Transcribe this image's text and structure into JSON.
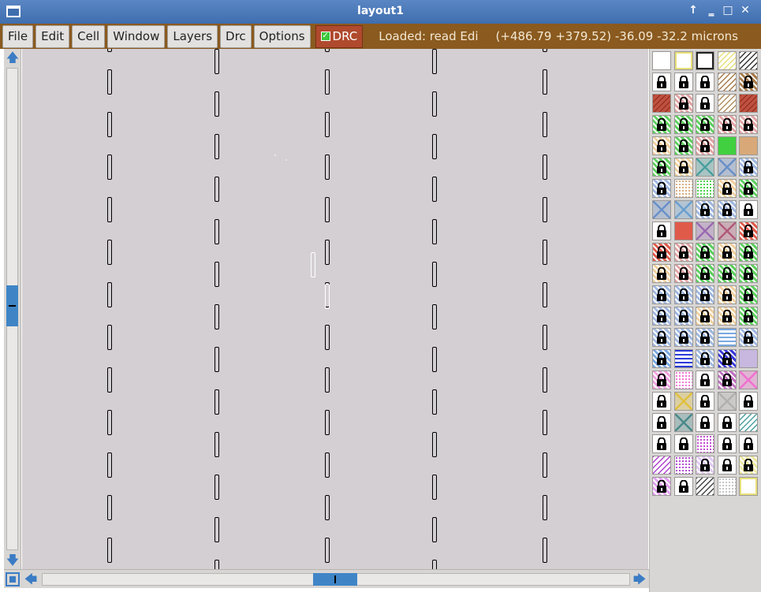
{
  "window": {
    "title": "layout1",
    "controls": [
      "↑",
      "‗",
      "□",
      "✕"
    ]
  },
  "menu": {
    "items": [
      "File",
      "Edit",
      "Cell",
      "Window",
      "Layers",
      "Drc",
      "Options"
    ],
    "drc_toggle_label": "DRC",
    "drc_checked": true,
    "status": "Loaded: read Edi",
    "coords": "(+486.79 +379.52) -36.09 -32.2 microns"
  },
  "colors": {
    "title_bar": "#4a7bbd",
    "menu_bar": "#8a5a1f",
    "drc_button": "#b04a2e",
    "canvas": "#d4cfd3",
    "scroll_thumb": "#3f85c6"
  },
  "scrollbars": {
    "vertical_position": 0.5,
    "horizontal_position": 0.55
  },
  "canvas": {
    "pattern": "repeating column of vertical dash outlines (layout geometry)",
    "selected_shapes": 2
  },
  "layers": [
    {
      "style": "dots",
      "color": "#ffffff"
    },
    {
      "style": "outline",
      "color": "#e8e07a"
    },
    {
      "style": "outline",
      "color": "#222222"
    },
    {
      "style": "diag",
      "color": "#e8e07a"
    },
    {
      "style": "diag",
      "color": "#333333"
    },
    {
      "style": "lock",
      "color": "#ffffff"
    },
    {
      "style": "lock",
      "color": "#ffffff"
    },
    {
      "style": "lock",
      "color": "#ffffff"
    },
    {
      "style": "diag",
      "color": "#a77b4a"
    },
    {
      "style": "lock",
      "color": "#a77b4a"
    },
    {
      "style": "solid-diag",
      "color": "#c0503e"
    },
    {
      "style": "lock",
      "color": "#e2a4a4"
    },
    {
      "style": "lock",
      "color": "#ffffff"
    },
    {
      "style": "diag",
      "color": "#b09060"
    },
    {
      "style": "solid-diag",
      "color": "#c0503e"
    },
    {
      "style": "lock",
      "color": "#5fd05f"
    },
    {
      "style": "lock",
      "color": "#5fd05f"
    },
    {
      "style": "lock",
      "color": "#5fd05f"
    },
    {
      "style": "lock",
      "color": "#e2a4a4"
    },
    {
      "style": "lock",
      "color": "#e2a4a4"
    },
    {
      "style": "lock",
      "color": "#f0d0a0"
    },
    {
      "style": "lock",
      "color": "#5fd05f"
    },
    {
      "style": "lock",
      "color": "#e2a4a4"
    },
    {
      "style": "solid",
      "color": "#40d040"
    },
    {
      "style": "solid",
      "color": "#d8a878"
    },
    {
      "style": "lock",
      "color": "#5fd05f"
    },
    {
      "style": "lock",
      "color": "#f0d0a0"
    },
    {
      "style": "cross",
      "color": "#4aa0a0"
    },
    {
      "style": "cross",
      "color": "#6a90c8"
    },
    {
      "style": "lock",
      "color": "#a0b8e0"
    },
    {
      "style": "lock",
      "color": "#a0b8e0"
    },
    {
      "style": "dots",
      "color": "#d8a878"
    },
    {
      "style": "dots",
      "color": "#40d040"
    },
    {
      "style": "lock",
      "color": "#f0d0a0"
    },
    {
      "style": "lock",
      "color": "#5fd05f"
    },
    {
      "style": "cross",
      "color": "#6a90c8"
    },
    {
      "style": "cross",
      "color": "#6aa0d0"
    },
    {
      "style": "lock",
      "color": "#a0b8e0"
    },
    {
      "style": "lock",
      "color": "#a0b8e0"
    },
    {
      "style": "lock",
      "color": "#ffffff"
    },
    {
      "style": "lock",
      "color": "#ffffff"
    },
    {
      "style": "solid",
      "color": "#e05a4a"
    },
    {
      "style": "cross",
      "color": "#9a6ab0"
    },
    {
      "style": "cross",
      "color": "#b05a7a"
    },
    {
      "style": "lock",
      "color": "#e05a4a"
    },
    {
      "style": "lock",
      "color": "#e05a4a"
    },
    {
      "style": "lock",
      "color": "#e2a4a4"
    },
    {
      "style": "lock",
      "color": "#5fd05f"
    },
    {
      "style": "lock",
      "color": "#f0d0a0"
    },
    {
      "style": "lock",
      "color": "#5fd05f"
    },
    {
      "style": "lock",
      "color": "#f0d0a0"
    },
    {
      "style": "lock",
      "color": "#e2a4a4"
    },
    {
      "style": "lock",
      "color": "#5fd05f"
    },
    {
      "style": "lock",
      "color": "#5fd05f"
    },
    {
      "style": "lock",
      "color": "#5fd05f"
    },
    {
      "style": "lock",
      "color": "#a0b8e0"
    },
    {
      "style": "lock",
      "color": "#a0b8e0"
    },
    {
      "style": "lock",
      "color": "#a0b8e0"
    },
    {
      "style": "lock",
      "color": "#f0d0a0"
    },
    {
      "style": "lock",
      "color": "#5fd05f"
    },
    {
      "style": "lock",
      "color": "#a0b8e0"
    },
    {
      "style": "lock",
      "color": "#a0b8e0"
    },
    {
      "style": "lock",
      "color": "#f0d0a0"
    },
    {
      "style": "lock",
      "color": "#f0d0a0"
    },
    {
      "style": "lock",
      "color": "#5fd05f"
    },
    {
      "style": "lock",
      "color": "#a0b8e0"
    },
    {
      "style": "lock",
      "color": "#a0b8e0"
    },
    {
      "style": "lock",
      "color": "#a0b8e0"
    },
    {
      "style": "wave",
      "color": "#7aa8e0"
    },
    {
      "style": "lock",
      "color": "#a0b8e0"
    },
    {
      "style": "lock",
      "color": "#7aa8e0"
    },
    {
      "style": "wave",
      "color": "#2a3ad8"
    },
    {
      "style": "lock",
      "color": "#a0b8e0"
    },
    {
      "style": "lock",
      "color": "#3a3ad8"
    },
    {
      "style": "solid",
      "color": "#c8b8e0"
    },
    {
      "style": "lock",
      "color": "#f0a0e0"
    },
    {
      "style": "dots",
      "color": "#f070d0"
    },
    {
      "style": "lock",
      "color": "#ffffff"
    },
    {
      "style": "lock",
      "color": "#c070c0"
    },
    {
      "style": "cross",
      "color": "#f070d0"
    },
    {
      "style": "lock",
      "color": "#ffffff"
    },
    {
      "style": "cross",
      "color": "#e0c040"
    },
    {
      "style": "lock",
      "color": "#ffffff"
    },
    {
      "style": "cross",
      "color": "#b0b0b0"
    },
    {
      "style": "lock",
      "color": "#ffffff"
    },
    {
      "style": "lock",
      "color": "#ffffff"
    },
    {
      "style": "cross",
      "color": "#4a8a8a"
    },
    {
      "style": "lock",
      "color": "#ffffff"
    },
    {
      "style": "lock",
      "color": "#ffffff"
    },
    {
      "style": "diag",
      "color": "#4aa0a0"
    },
    {
      "style": "lock",
      "color": "#ffffff"
    },
    {
      "style": "lock",
      "color": "#ffffff"
    },
    {
      "style": "dots",
      "color": "#c040d0"
    },
    {
      "style": "lock",
      "color": "#ffffff"
    },
    {
      "style": "lock",
      "color": "#ffffff"
    },
    {
      "style": "diag",
      "color": "#b040d0"
    },
    {
      "style": "dots",
      "color": "#b040d0"
    },
    {
      "style": "lock",
      "color": "#e0c8f0"
    },
    {
      "style": "lock",
      "color": "#ffffff"
    },
    {
      "style": "lock",
      "color": "#f0e8a0"
    },
    {
      "style": "lock",
      "color": "#e0a0f0"
    },
    {
      "style": "lock",
      "color": "#ffffff"
    },
    {
      "style": "diag",
      "color": "#444444"
    },
    {
      "style": "dots",
      "color": "#c0c0c0"
    },
    {
      "style": "outline",
      "color": "#e8e07a"
    }
  ]
}
